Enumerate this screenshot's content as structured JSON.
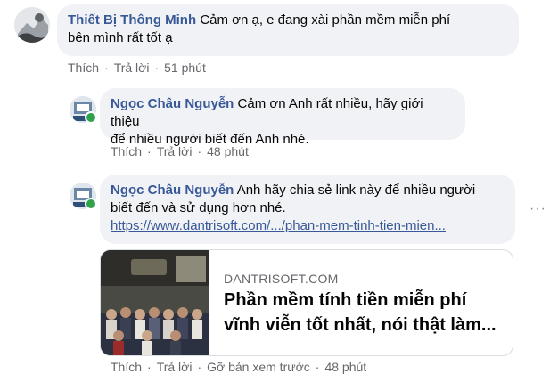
{
  "comment": {
    "author": "Thiết Bị Thông Minh",
    "text_line1": "Cảm ơn ạ, e đang xài phần mềm miễn phí",
    "text_line2": "bên mình rất tốt ạ",
    "like": "Thích",
    "reply": "Trả lời",
    "time": "51 phút"
  },
  "reply1": {
    "author": "Ngọc Châu Nguyễn",
    "text_line1": "Cảm ơn Anh rất nhiều, hãy giới thiệu",
    "text_line2": "để nhiều người biết đến Anh nhé.",
    "like": "Thích",
    "reply": "Trả lời",
    "time": "48 phút"
  },
  "reply2": {
    "author": "Ngọc Châu Nguyễn",
    "text_line1": "Anh hãy chia sẻ link này để nhiều người",
    "text_line2": "biết đến và sử dụng hơn nhé.",
    "link": "https://www.dantrisoft.com/.../phan-mem-tinh-tien-mien...",
    "like": "Thích",
    "reply": "Trả lời",
    "remove_preview": "Gỡ bản xem trước",
    "time": "48 phút",
    "more": "···"
  },
  "link_preview": {
    "domain": "DANTRISOFT.COM",
    "title_line1": "Phần mềm tính tiền miễn phí",
    "title_line2": "vĩnh viễn tốt nhất, nói thật làm..."
  },
  "separator": "·",
  "colors": {
    "author": "#385898",
    "meta": "#65676b",
    "bubble": "#f0f2f5",
    "online": "#31a24c"
  }
}
